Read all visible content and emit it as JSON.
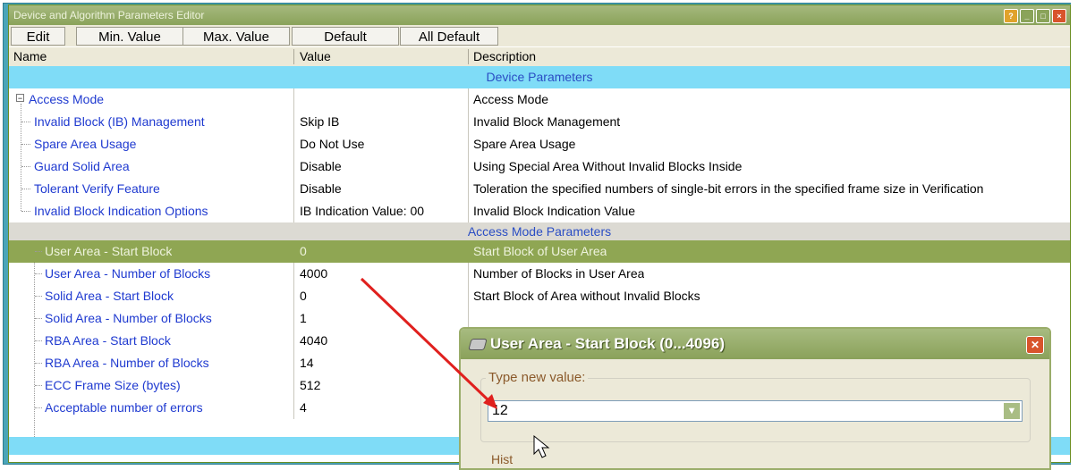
{
  "window": {
    "title": "Device and Algorithm Parameters Editor",
    "title_buttons": [
      "?",
      "_",
      "□",
      "×"
    ]
  },
  "toolbar": [
    "Edit",
    "Min. Value",
    "Max. Value",
    "Default",
    "All Default"
  ],
  "columns": [
    "Name",
    "Value",
    "Description"
  ],
  "sections": [
    {
      "label": "Device Parameters"
    },
    {
      "label": "Access Mode Parameters"
    }
  ],
  "rows": [
    {
      "name": "Access Mode",
      "value": "",
      "description": "Access Mode"
    },
    {
      "name": "Invalid Block (IB) Management",
      "value": "Skip IB",
      "description": "Invalid Block Management"
    },
    {
      "name": "Spare Area Usage",
      "value": "Do Not Use",
      "description": "Spare Area Usage"
    },
    {
      "name": "Guard Solid Area",
      "value": "Disable",
      "description": "Using Special Area Without Invalid Blocks Inside"
    },
    {
      "name": "Tolerant Verify Feature",
      "value": "Disable",
      "description": "Toleration the specified numbers of single-bit errors in the specified frame size in Verification"
    },
    {
      "name": "Invalid Block Indication Options",
      "value": "IB Indication Value: 00",
      "description": "Invalid Block Indication Value"
    },
    {
      "name": "User Area - Start Block",
      "value": "0",
      "description": "Start Block of User Area"
    },
    {
      "name": "User Area - Number of Blocks",
      "value": "4000",
      "description": "Number of Blocks in User Area"
    },
    {
      "name": "Solid Area - Start Block",
      "value": "0",
      "description": "Start Block of Area without Invalid Blocks"
    },
    {
      "name": "Solid Area - Number of Blocks",
      "value": "1",
      "description": ""
    },
    {
      "name": "RBA Area - Start Block",
      "value": "4040",
      "description": ""
    },
    {
      "name": "RBA Area - Number of Blocks",
      "value": "14",
      "description": ""
    },
    {
      "name": "ECC Frame Size (bytes)",
      "value": "512",
      "description": ""
    },
    {
      "name": "Acceptable number of errors",
      "value": "4",
      "description": ""
    }
  ],
  "dialog": {
    "title": "User Area - Start Block  (0...4096)",
    "legend": "Type new value:",
    "value": "12",
    "history_label": "Hist"
  },
  "colors": {
    "selected_row": "#8fa653",
    "section_band": "#7fdcf7",
    "link_text": "#1f3ad0",
    "annotation_arrow": "#e0201e"
  }
}
